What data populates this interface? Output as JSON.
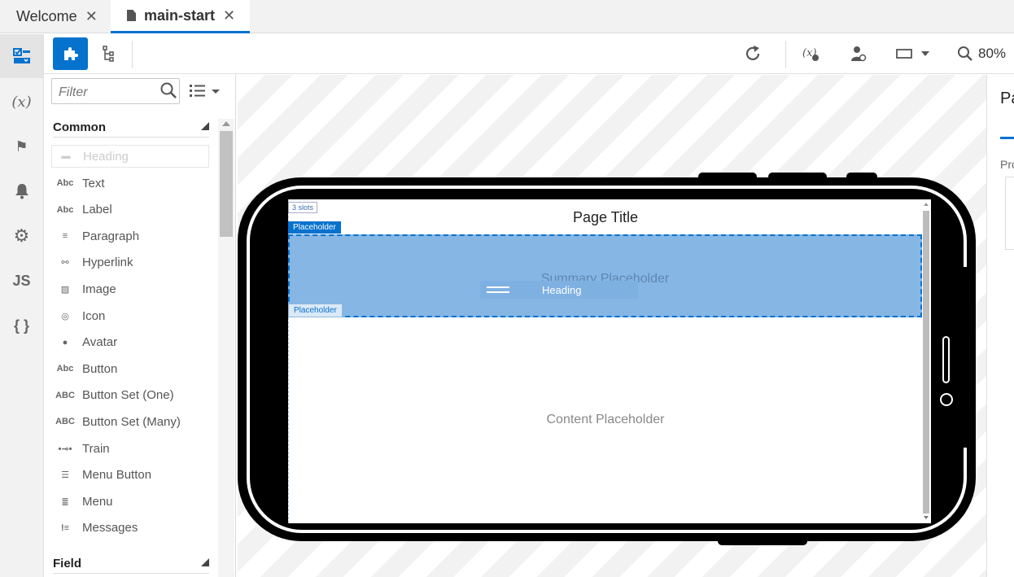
{
  "tabs": [
    {
      "label": "Welcome",
      "close": "✕"
    },
    {
      "label": "main-start",
      "close": "✕"
    }
  ],
  "rail": {
    "items": [
      {
        "icon": "page-designer-icon",
        "glyph": "▣"
      },
      {
        "icon": "variables-icon",
        "glyph": "(x)"
      },
      {
        "icon": "flag-icon",
        "glyph": "⚑"
      },
      {
        "icon": "bell-icon",
        "glyph": "🔔"
      },
      {
        "icon": "gear-icon",
        "glyph": "⚙"
      },
      {
        "icon": "javascript-icon",
        "glyph": "JS"
      },
      {
        "icon": "json-icon",
        "glyph": "{ }"
      }
    ]
  },
  "toolbar": {
    "components_icon": "puzzle-icon",
    "structure_icon": "tree-icon",
    "refresh_icon": "refresh-icon",
    "variables_icon": "variables-icon",
    "user_icon": "user-icon",
    "device_icon": "device-icon",
    "zoom_icon": "zoom-icon",
    "zoom": "80%"
  },
  "palette": {
    "filter_placeholder": "Filter",
    "sections": {
      "common": "Common",
      "field": "Field"
    },
    "ghost_item": "Heading",
    "items": [
      {
        "label": "Text",
        "icon": "text-icon",
        "glyph": "Abc"
      },
      {
        "label": "Label",
        "icon": "label-icon",
        "glyph": "Abc"
      },
      {
        "label": "Paragraph",
        "icon": "paragraph-icon",
        "glyph": "≡"
      },
      {
        "label": "Hyperlink",
        "icon": "link-icon",
        "glyph": "⚯"
      },
      {
        "label": "Image",
        "icon": "image-icon",
        "glyph": "▨"
      },
      {
        "label": "Icon",
        "icon": "icon-icon",
        "glyph": "◎"
      },
      {
        "label": "Avatar",
        "icon": "avatar-icon",
        "glyph": "●"
      },
      {
        "label": "Button",
        "icon": "button-icon",
        "glyph": "Abc"
      },
      {
        "label": "Button Set (One)",
        "icon": "button-set-one-icon",
        "glyph": "ABC"
      },
      {
        "label": "Button Set (Many)",
        "icon": "button-set-many-icon",
        "glyph": "ABC"
      },
      {
        "label": "Train",
        "icon": "train-icon",
        "glyph": "•⊸•"
      },
      {
        "label": "Menu Button",
        "icon": "menu-button-icon",
        "glyph": "☰"
      },
      {
        "label": "Menu",
        "icon": "menu-icon",
        "glyph": "≣"
      },
      {
        "label": "Messages",
        "icon": "messages-icon",
        "glyph": "!≡"
      }
    ]
  },
  "canvas": {
    "slots_badge": "3 slots",
    "page_title": "Page Title",
    "placeholder_tag": "Placeholder",
    "summary_placeholder": "Summary Placeholder",
    "drag_ghost": "Heading",
    "content_placeholder": "Content Placeholder"
  },
  "right_panel": {
    "title": "Pa",
    "label": "Pro"
  }
}
